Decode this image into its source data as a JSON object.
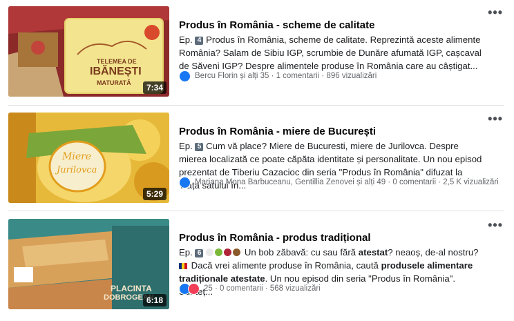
{
  "items": [
    {
      "title": "Produs în România - scheme de calitate",
      "ep_label": "Ep.",
      "ep_num": "4",
      "description": "Produs în România, scheme de calitate. Reprezintă aceste alimente România? Salam de Sibiu IGP, scrumbie de Dunăre afumată IGP, cașcaval de Săveni IGP? Despre alimentele produse în România care au câștigat...",
      "meta": "Bercu Florin și alți 35 · 1 comentarii · 896 vizualizări",
      "duration": "7:34",
      "thumb_text": [
        "TELEMEA DE",
        "IBĂNEȘTI",
        "MATURATĂ"
      ]
    },
    {
      "title": "Produs în România - miere de București",
      "ep_label": "Ep.",
      "ep_num": "5",
      "description": "Cum vă place? Miere de Bucuresti, miere de Jurilovca. Despre mierea localizată ce poate căpăta identitate și personalitate. Un nou episod prezentat de Tiberiu Cazacioc din seria \"Produs în România\" difuzat la Viața satului în...",
      "meta": "Mariana Mona Barbuceanu, Gentillia Zenovei și alți 49 · 0 comentarii · 2,5 K vizualizări",
      "duration": "5:29",
      "thumb_text": [
        "Miere",
        "Jurilovca"
      ]
    },
    {
      "title": "Produs în România - produs tradițional",
      "ep_label": "Ep.",
      "ep_num": "6",
      "desc_a": "Un bob zăbavă: cu sau fără ",
      "desc_b": "atestat",
      "desc_c": "? neaoș, de-al nostru?",
      "desc_d": "Dacă vrei alimente produse în România, caută ",
      "desc_e": "produsele alimentare tradiționale atestate",
      "desc_f": ". Un nou episod din seria \"Produs în România\". Sunteț...",
      "meta": "25 · 0 comentarii · 568 vizualizări",
      "duration": "6:18",
      "thumb_text": [
        "PLACINTA",
        "DOBROGEAN"
      ]
    }
  ],
  "more_glyph": "•••",
  "icons": [
    "like-icon",
    "love-icon",
    "more-options-icon",
    "episode-number-icon"
  ],
  "colors": {
    "link": "#1877f2",
    "meta": "#65676b",
    "separator": "#dddfe2"
  }
}
